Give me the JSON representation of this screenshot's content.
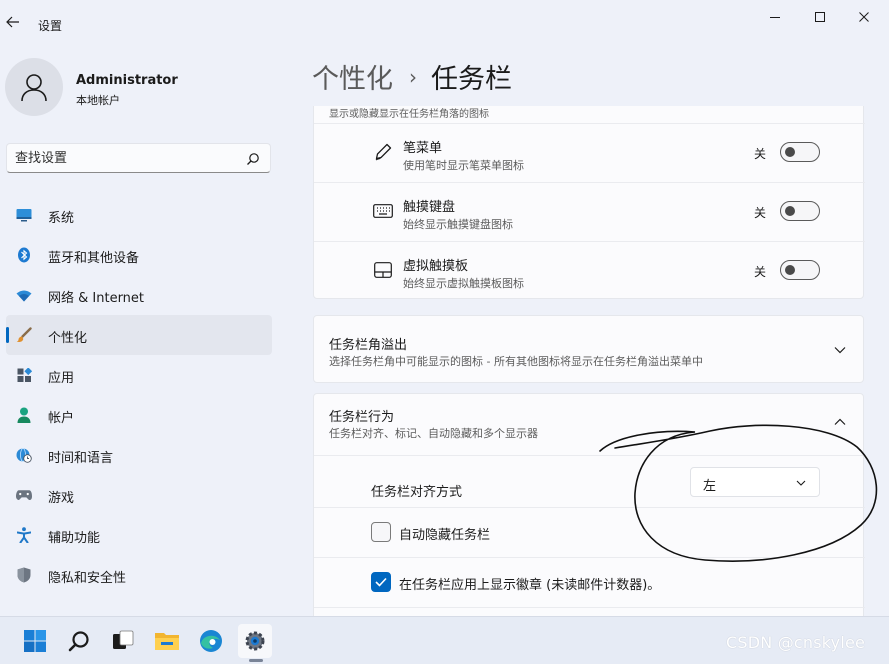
{
  "window": {
    "title": "设置",
    "buttons": [
      "minimize-icon",
      "maximize-icon",
      "close-icon"
    ]
  },
  "user": {
    "name": "Administrator",
    "account_type": "本地帐户"
  },
  "search": {
    "placeholder": "查找设置"
  },
  "sidebar": {
    "items": [
      {
        "label": "系统",
        "icon": "system-icon"
      },
      {
        "label": "蓝牙和其他设备",
        "icon": "bluetooth-icon"
      },
      {
        "label": "网络 & Internet",
        "icon": "wifi-icon"
      },
      {
        "label": "个性化",
        "icon": "brush-icon",
        "active": true
      },
      {
        "label": "应用",
        "icon": "apps-icon"
      },
      {
        "label": "帐户",
        "icon": "account-icon"
      },
      {
        "label": "时间和语言",
        "icon": "globe-clock-icon"
      },
      {
        "label": "游戏",
        "icon": "gamepad-icon"
      },
      {
        "label": "辅助功能",
        "icon": "accessibility-icon"
      },
      {
        "label": "隐私和安全性",
        "icon": "shield-icon"
      }
    ]
  },
  "breadcrumb": {
    "parent": "个性化",
    "separator": "›",
    "current": "任务栏"
  },
  "corner_icons": {
    "clipped_description": "显示或隐藏显示在任务栏角落的图标",
    "rows": [
      {
        "title": "笔菜单",
        "description": "使用笔时显示笔菜单图标",
        "state": "关",
        "icon": "pen-icon"
      },
      {
        "title": "触摸键盘",
        "description": "始终显示触摸键盘图标",
        "state": "关",
        "icon": "keyboard-icon"
      },
      {
        "title": "虚拟触摸板",
        "description": "始终显示虚拟触摸板图标",
        "state": "关",
        "icon": "touchpad-icon"
      }
    ]
  },
  "corner_overflow": {
    "title": "任务栏角溢出",
    "description": "选择任务栏角中可能显示的图标 - 所有其他图标将显示在任务栏角溢出菜单中"
  },
  "behaviors": {
    "title": "任务栏行为",
    "description": "任务栏对齐、标记、自动隐藏和多个显示器",
    "alignment_label": "任务栏对齐方式",
    "alignment_value": "左",
    "auto_hide_label": "自动隐藏任务栏",
    "auto_hide_checked": false,
    "badges_label": "在任务栏应用上显示徽章 (未读邮件计数器)。",
    "badges_checked": true
  },
  "taskbar": {
    "icons": [
      "start-icon",
      "search-icon",
      "task-view-icon",
      "file-explorer-icon",
      "edge-icon",
      "settings-icon"
    ]
  },
  "watermark": "CSDN @cnskylee",
  "colors": {
    "accent": "#0067c0",
    "background": "#eef1f9",
    "card": "#fbfbfd"
  }
}
